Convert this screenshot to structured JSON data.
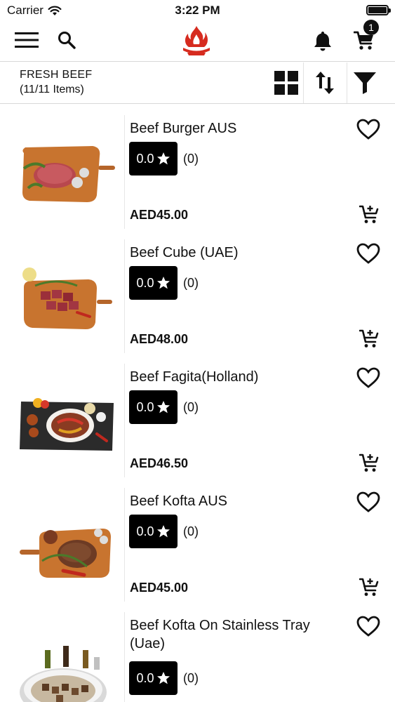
{
  "status": {
    "carrier": "Carrier",
    "time": "3:22 PM"
  },
  "nav": {
    "cart_count": "1"
  },
  "category": {
    "title": "FRESH BEEF",
    "count": "(11/11 Items)"
  },
  "products": [
    {
      "name": "Beef Burger AUS",
      "rating": "0.0",
      "reviews": "(0)",
      "price": "AED45.00"
    },
    {
      "name": "Beef Cube (UAE)",
      "rating": "0.0",
      "reviews": "(0)",
      "price": "AED48.00"
    },
    {
      "name": "Beef Fagita(Holland)",
      "rating": "0.0",
      "reviews": "(0)",
      "price": "AED46.50"
    },
    {
      "name": "Beef Kofta AUS",
      "rating": "0.0",
      "reviews": "(0)",
      "price": "AED45.00"
    },
    {
      "name": "Beef Kofta On Stainless Tray (Uae)",
      "rating": "0.0",
      "reviews": "(0)",
      "price": ""
    }
  ],
  "icons": {
    "menu": "hamburger-menu-icon",
    "search": "search-icon",
    "logo": "flame-logo",
    "bell": "bell-icon",
    "cart": "cart-icon",
    "grid": "grid-view-icon",
    "sort": "sort-icon",
    "filter": "filter-icon",
    "favorite": "heart-outline-icon",
    "star": "star-icon",
    "add_to_cart": "add-to-cart-icon"
  },
  "colors": {
    "brand_red": "#d62b1f",
    "text": "#111111",
    "divider": "#d8d8d8"
  }
}
